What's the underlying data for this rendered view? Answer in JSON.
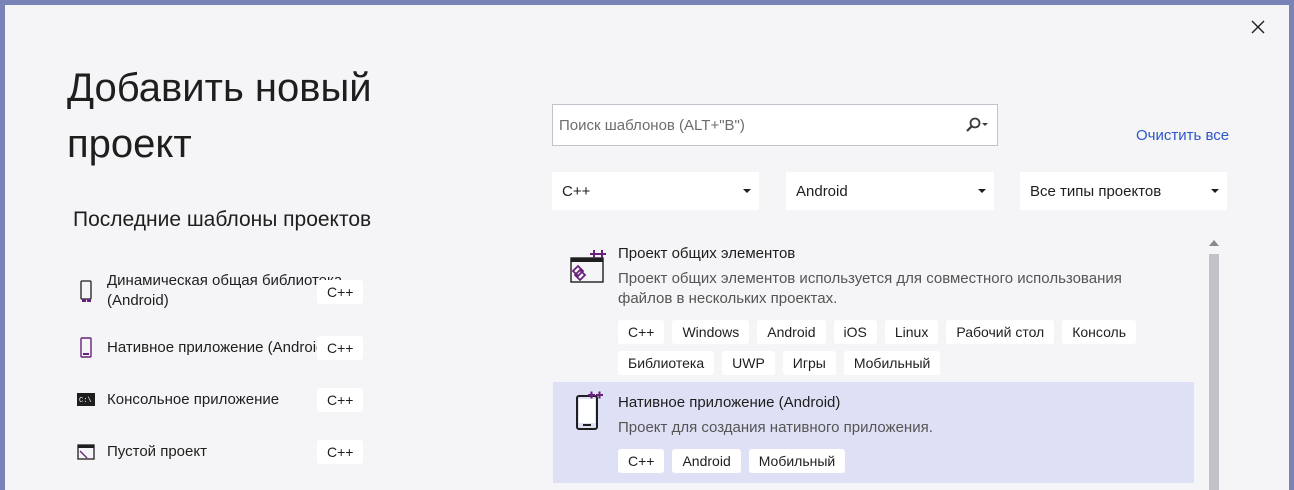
{
  "dialog": {
    "title": "Добавить новый проект",
    "close_icon": "close-icon"
  },
  "recent": {
    "heading": "Последние шаблоны проектов",
    "items": [
      {
        "label": "Динамическая общая библиотека (Android)",
        "lang": "C++",
        "icon": "android-library-icon"
      },
      {
        "label": "Нативное приложение (Android)",
        "lang": "C++",
        "icon": "android-app-icon"
      },
      {
        "label": "Консольное приложение",
        "lang": "C++",
        "icon": "console-app-icon"
      },
      {
        "label": "Пустой проект",
        "lang": "C++",
        "icon": "empty-project-icon"
      }
    ]
  },
  "search": {
    "placeholder": "Поиск шаблонов (ALT+\"В\")",
    "value": "",
    "icon": "search-icon"
  },
  "clear_all": "Очистить все",
  "filters": {
    "language": "C++",
    "platform": "Android",
    "project_type": "Все типы проектов"
  },
  "templates": [
    {
      "name": "Проект общих элементов",
      "description": "Проект общих элементов используется для совместного использования файлов в нескольких проектах.",
      "tags": [
        "C++",
        "Windows",
        "Android",
        "iOS",
        "Linux",
        "Рабочий стол",
        "Консоль",
        "Библиотека",
        "UWP",
        "Игры",
        "Мобильный"
      ],
      "selected": false,
      "icon": "shared-items-icon"
    },
    {
      "name": "Нативное приложение (Android)",
      "description": "Проект для создания нативного приложения.",
      "tags": [
        "C++",
        "Android",
        "Мобильный"
      ],
      "selected": true,
      "icon": "native-android-app-icon"
    }
  ],
  "colors": {
    "accent": "#68217a",
    "link": "#2b57c8",
    "selected_bg": "#dee0f5",
    "window_border": "#7884b8"
  }
}
